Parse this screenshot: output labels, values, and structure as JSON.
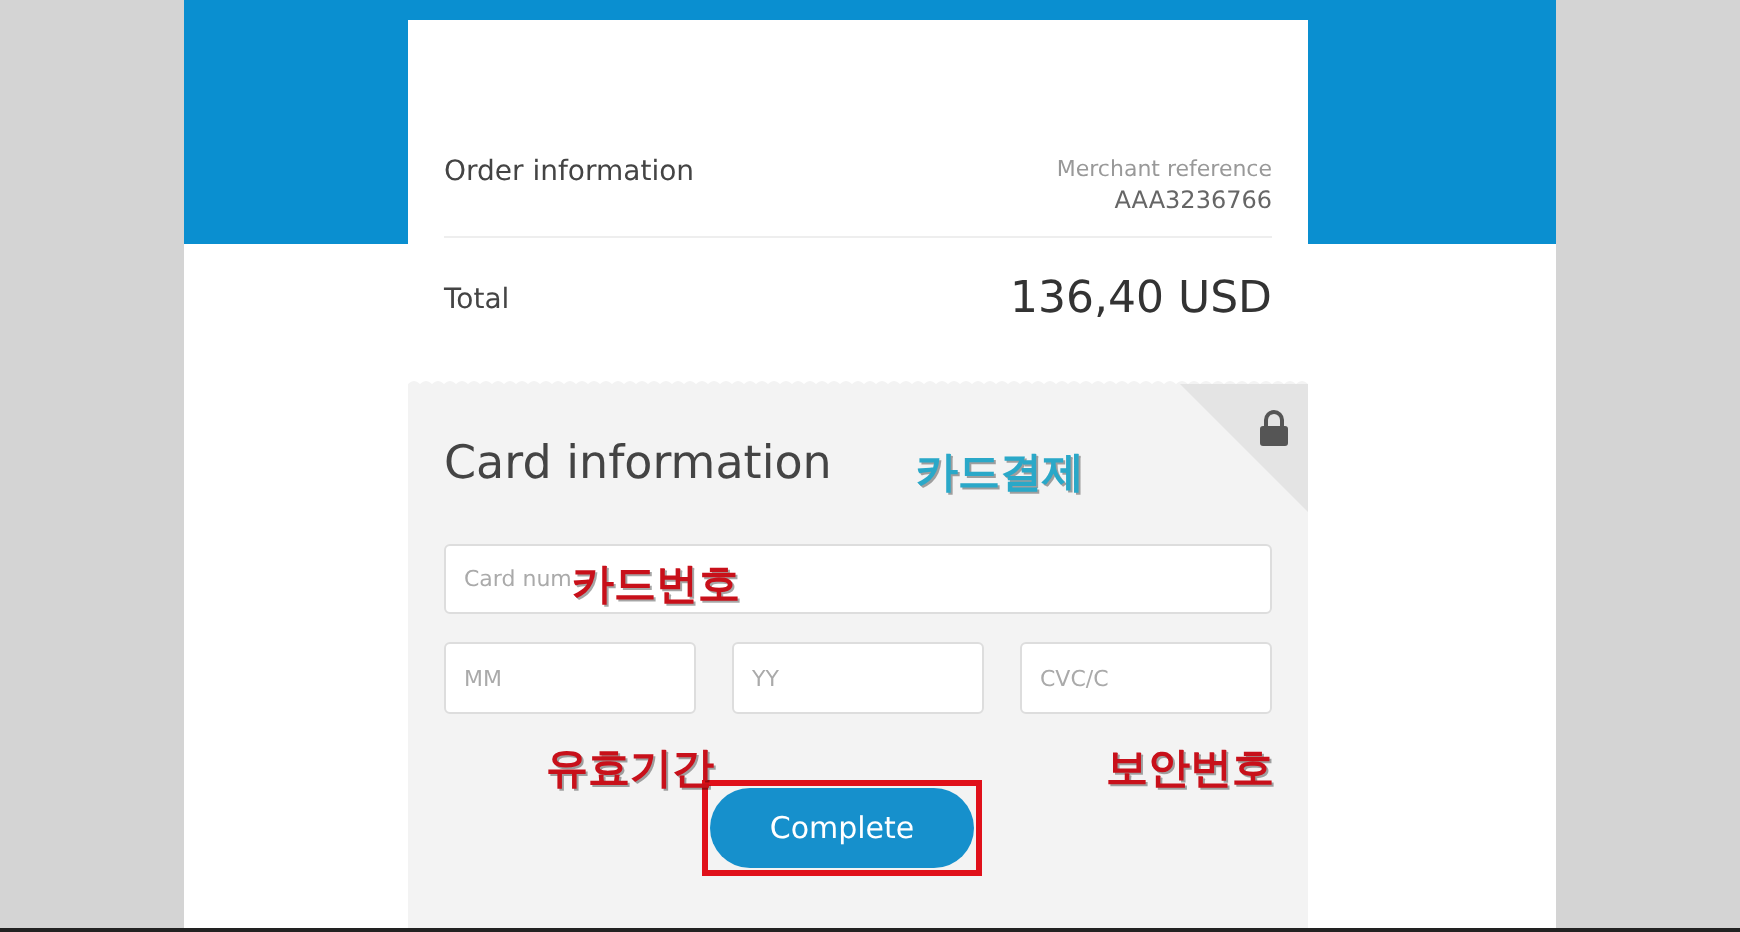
{
  "order": {
    "title": "Order information",
    "reference_label": "Merchant reference",
    "reference": "AAA3236766",
    "total_label": "Total",
    "total": "136,40 USD"
  },
  "card": {
    "title": "Card information",
    "number": {
      "placeholder": "Card num"
    },
    "month": {
      "placeholder": "MM"
    },
    "year": {
      "placeholder": "YY"
    },
    "cvc": {
      "placeholder": "CVC/C"
    },
    "button": "Complete"
  },
  "annotations": [
    {
      "text": "카드결제",
      "color": "#2aa8c8"
    },
    {
      "text": "카드번호",
      "color": "#c8101a"
    },
    {
      "text": "유효기간",
      "color": "#c8101a"
    },
    {
      "text": "보안번호",
      "color": "#c8101a"
    }
  ]
}
